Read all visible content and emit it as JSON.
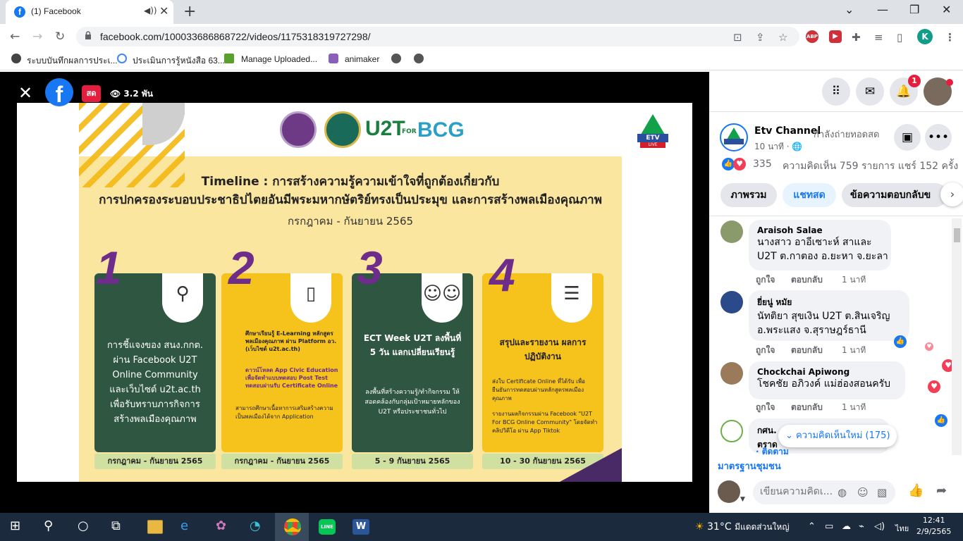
{
  "browser": {
    "tab_title": "(1) Facebook",
    "tab_close": "✕",
    "new_tab": "+",
    "window_controls": [
      "⌄",
      "—",
      "❐",
      "✕"
    ],
    "url": "facebook.com/100033686868722/videos/1175318319727298/",
    "profile_initial": "K",
    "bookmarks": [
      "ระบบบันทึกผลการประเ...",
      "ประเมินการรู้หนังสือ 63...",
      "Manage Uploaded...",
      "animaker"
    ]
  },
  "video": {
    "live_label": "สด",
    "views": "3.2 พัน",
    "poster": {
      "u2t": "U2T",
      "for": "FOR",
      "bcg": "BCG",
      "title_line1": "Timeline : การสร้างความรู้ความเข้าใจที่ถูกต้องเกี่ยวกับ",
      "title_line2": "การปกครองระบอบประชาธิปไตยอันมีพระมหากษัตริย์ทรงเป็นประมุข และการสร้างพลเมืองคุณภาพ",
      "period": "กรกฎาคม - กันยายน 2565",
      "steps": [
        {
          "num": "1",
          "text": "การชี้แจงของ สนง.กกต. ผ่าน Facebook U2T Online Community และเว็บไซต์ u2t.ac.th เพื่อรับทราบภารกิจการสร้างพลเมืองคุณภาพ",
          "date": "กรกฎาคม - กันยายน 2565"
        },
        {
          "num": "2",
          "text": "ศึกษาเรียนรู้ E-Learning หลักสูตรพลเมืองคุณภาพ ผ่าน Platform อว. (เว็บไซต์ u2t.ac.th)",
          "text2": "ดาวน์โหลด App Civic Education เพื่อจัดทำแบบทดสอบ Post Test ทดสอบผ่านรับ Certificate Online",
          "text3": "สามารถศึกษาเนื้อหาการเสริมสร้างความเป็นพลเมืองได้จาก Application",
          "date": "กรกฎาคม - กันยายน 2565"
        },
        {
          "num": "3",
          "title": "ECT Week U2T ลงพื้นที่ 5 วัน แลกเปลี่ยนเรียนรู้",
          "text": "ลงพื้นที่สร้างความรู้/ทำกิจกรรม ให้สอดคล้องกับกลุ่มเป้าหมายหลักของ U2T หรือประชาชนทั่วไป",
          "date": "5 - 9 กันยายน 2565"
        },
        {
          "num": "4",
          "title": "สรุปและรายงาน ผลการปฏิบัติงาน",
          "text": "ส่งใบ Certificate Online ที่ได้รับ เพื่อยืนยันการทดสอบผ่านหลักสูตรพลเมืองคุณภาพ",
          "text2": "รายงานผลกิจกรรมผ่าน Facebook \"U2T For BCG Online Community\" โดยจัดทำคลิปวิดีโอ ผ่าน App Tiktok",
          "date": "10 - 30 กันยายน 2565"
        }
      ],
      "etv": "ETV",
      "etv_live": "LIVE"
    }
  },
  "panel": {
    "notifications_badge": "1",
    "page_name": "Etv Channel",
    "page_status": "กำลังถ่ายทอดสด",
    "page_time": "10 นาที ·",
    "reactions_count": "335",
    "comments_shares": "ความคิดเห็น 759 รายการ  แชร์ 152 ครั้ง",
    "tabs": [
      "ภาพรวม",
      "แชทสด",
      "ข้อความตอบกลับข"
    ],
    "comments": [
      {
        "name": "Araisoh Salae",
        "lines": [
          "นางสาว อาอีเซาะห์ สาและ",
          "U2T ต.กาตอง อ.ยะหา จ.ยะลา"
        ],
        "like": "ถูกใจ",
        "reply": "ตอบกลับ",
        "time": "1 นาที"
      },
      {
        "name": "ยี่ยนู่ หมัย",
        "lines": [
          "นัทติยา สุขเงิน U2T ต.สินเจริญ",
          "อ.พระแสง จ.สุราษฎร์ธานี"
        ],
        "like": "ถูกใจ",
        "reply": "ตอบกลับ",
        "time": "1 นาที"
      },
      {
        "name": "Chockchai Apiwong",
        "lines": [
          "โชคชัย อภิวงค์ แม่ฮ่องสอนครับ"
        ],
        "like": "ถูกใจ",
        "reply": "ตอบกลับ",
        "time": "1 นาที"
      },
      {
        "name": "กศน.",
        "lines": [
          "ตราด"
        ],
        "follow": "· ติดตาม"
      }
    ],
    "new_comments": "ความคิดเห็นใหม่ (175)",
    "standards_link": "มาตรฐานชุมชน",
    "composer_placeholder": "เขียนความคิดเ..."
  },
  "taskbar": {
    "temperature": "31°C",
    "weather_text": "มีแดดส่วนใหญ่",
    "language": "ไทย",
    "time": "12:41",
    "date": "2/9/2565"
  }
}
